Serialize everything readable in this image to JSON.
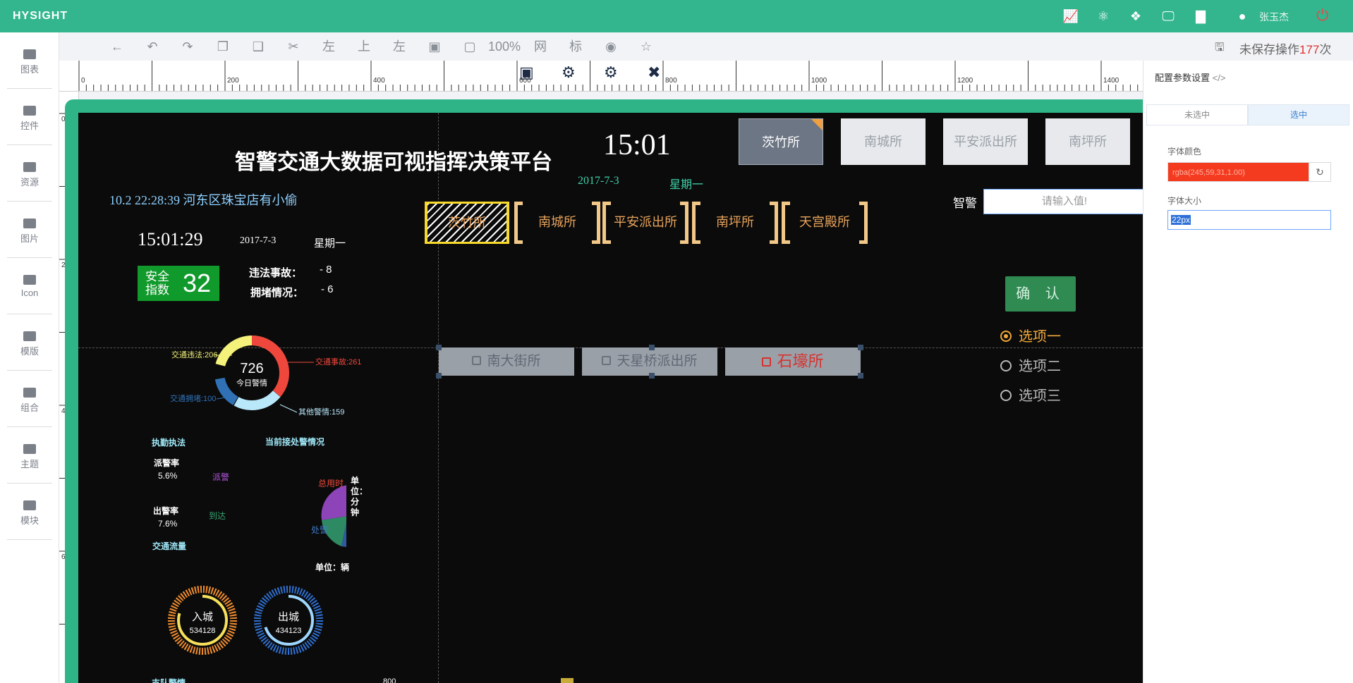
{
  "app": {
    "logo": "HYSIGHT",
    "user": "张玉杰"
  },
  "topbar": {
    "icons": [
      "line-chart-icon",
      "atom-icon",
      "puzzle-icon",
      "monitor-icon",
      "bar-chart-icon",
      "user-icon",
      "power-icon"
    ]
  },
  "sidebar": {
    "items": [
      {
        "label": "图表",
        "icon": "chart-icon"
      },
      {
        "label": "控件",
        "icon": "link-icon"
      },
      {
        "label": "资源",
        "icon": "book-icon"
      },
      {
        "label": "图片",
        "icon": "book-icon"
      },
      {
        "label": "Icon",
        "icon": "book-icon"
      },
      {
        "label": "模版",
        "icon": "copy-icon"
      },
      {
        "label": "组合",
        "icon": "compress-icon"
      },
      {
        "label": "主题",
        "icon": "pie-icon"
      },
      {
        "label": "模块",
        "icon": "file-icon"
      }
    ]
  },
  "toolbar": {
    "zoom": "100%",
    "grid": "网",
    "ruler": "标",
    "align_left": "左",
    "align_top": "上",
    "align_left2": "左",
    "unsaved_prefix": "未保存操作",
    "unsaved_count": "177",
    "unsaved_suffix": "次"
  },
  "ruler": {
    "h": [
      "0",
      "200",
      "400",
      "600",
      "800",
      "1000",
      "1200",
      "1400"
    ],
    "v": [
      "0",
      "200",
      "400",
      "600"
    ]
  },
  "canvas": {
    "title": "智警交通大数据可视指挥决策平台",
    "big_time": "15:01",
    "big_date": "2017-7-3",
    "big_week": "星期一",
    "top_tabs": [
      "茨竹所",
      "南城所",
      "平安派出所",
      "南坪所"
    ],
    "marquee": "10.2   22:28:39   河东区珠宝店有小偷",
    "time2": "15:01:29",
    "date2": "2017-7-3",
    "week2": "星期一",
    "safe_label": "安全指数",
    "safe_value": "32",
    "stats": [
      {
        "label": "违法事故：",
        "value": "-   8"
      },
      {
        "label": "拥堵情况：",
        "value": "-   6"
      }
    ],
    "donut": {
      "total": "726",
      "subtitle": "今日警情",
      "legend": [
        "交通违法:206",
        "交通事故:261",
        "交通拥堵:100",
        "其他警情:159"
      ]
    },
    "section1": "执勤执法",
    "section2": "当前接处警情况",
    "rates": [
      {
        "label": "派警率",
        "value": "5.6%"
      },
      {
        "label": "出警率",
        "value": "7.6%"
      }
    ],
    "pie_labels": [
      "派警",
      "总用时",
      "到达",
      "处警"
    ],
    "pie_unit": "单位：分钟",
    "traffic": "交通流量",
    "traffic_unit": "单位：辆",
    "gauges": [
      {
        "label": "入城",
        "value": "534128"
      },
      {
        "label": "出城",
        "value": "434123"
      }
    ],
    "bottom_label": "支队警情",
    "bottom_axis": "800",
    "bracket_tabs": [
      "茨竹所",
      "南城所",
      "平安派出所",
      "南坪所",
      "天宫殿所"
    ],
    "check_buttons": [
      {
        "label": "南大街所",
        "checked": false
      },
      {
        "label": "天星桥派出所",
        "checked": false
      },
      {
        "label": "石壕所",
        "checked": true
      }
    ],
    "input_label": "智警",
    "input_placeholder": "请输入值!",
    "confirm": "确 认",
    "radios": [
      {
        "label": "选项一",
        "selected": true
      },
      {
        "label": "选项二",
        "selected": false
      },
      {
        "label": "选项三",
        "selected": false
      }
    ]
  },
  "panel": {
    "title": "配置参数设置",
    "code_icon": "</>",
    "tabs": [
      "未选中",
      "选中"
    ],
    "font_color_label": "字体颜色",
    "font_color_value": "rgba(245,59,31,1.00)",
    "font_size_label": "字体大小",
    "font_size_value": "22px"
  },
  "colors": {
    "brand": "#33b68d",
    "canvas_bg": "#0b0b0b",
    "accent_orange": "#e8a35c",
    "selected_red": "#f53b1f"
  }
}
